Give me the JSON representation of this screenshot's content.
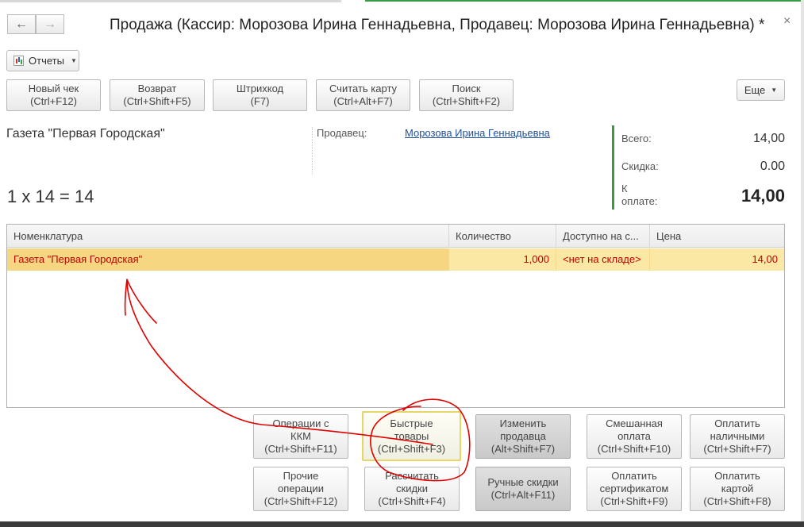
{
  "window": {
    "title": "Продажа (Кассир: Морозова Ирина Геннадьевна, Продавец: Морозова Ирина Геннадьевна) *",
    "close_label": "×"
  },
  "nav": {
    "back": "🡐",
    "forward": "🡒"
  },
  "reports": {
    "label": "Отчеты"
  },
  "toolbar": {
    "new_check": {
      "line1": "Новый чек",
      "line2": "(Ctrl+F12)"
    },
    "return": {
      "line1": "Возврат",
      "line2": "(Ctrl+Shift+F5)"
    },
    "barcode": {
      "line1": "Штрихкод",
      "line2": "(F7)"
    },
    "read_card": {
      "line1": "Считать карту",
      "line2": "(Ctrl+Alt+F7)"
    },
    "search": {
      "line1": "Поиск",
      "line2": "(Ctrl+Shift+F2)"
    },
    "more": "Еще"
  },
  "current": {
    "product_name": "Газета \"Первая Городская\"",
    "calc": "1 x 14 = 14",
    "seller_label": "Продавец:",
    "seller_name": "Морозова Ирина Геннадьевна"
  },
  "totals": {
    "total_label": "Всего:",
    "total_value": "14,00",
    "discount_label": "Скидка:",
    "discount_value": "0.00",
    "pay_label_1": "К",
    "pay_label_2": "оплате:",
    "pay_value": "14,00"
  },
  "table": {
    "columns": [
      "Номенклатура",
      "Количество",
      "Доступно на с...",
      "Цена"
    ],
    "rows": [
      {
        "name": "Газета \"Первая Городская\"",
        "qty": "1,000",
        "available": "<нет на складе>",
        "price": "14,00"
      }
    ]
  },
  "actions": {
    "kkm": {
      "line1": "Операции с",
      "line2": "ККМ",
      "line3": "(Ctrl+Shift+F11)"
    },
    "quick": {
      "line1": "Быстрые",
      "line2": "товары",
      "line3": "(Ctrl+Shift+F3)"
    },
    "change_seller": {
      "line1": "Изменить",
      "line2": "продавца",
      "line3": "(Alt+Shift+F7)"
    },
    "mixed": {
      "line1": "Смешанная",
      "line2": "оплата",
      "line3": "(Ctrl+Shift+F10)"
    },
    "cash": {
      "line1": "Оплатить",
      "line2": "наличными",
      "line3": "(Ctrl+Shift+F7)"
    },
    "other": {
      "line1": "Прочие",
      "line2": "операции",
      "line3": "(Ctrl+Shift+F12)"
    },
    "calc_discounts": {
      "line1": "Рассчитать",
      "line2": "скидки",
      "line3": "(Ctrl+Shift+F4)"
    },
    "manual_discounts": {
      "line1": "Ручные скидки",
      "line2": "(Ctrl+Alt+F11)"
    },
    "certificate": {
      "line1": "Оплатить",
      "line2": "сертификатом",
      "line3": "(Ctrl+Shift+F9)"
    },
    "card": {
      "line1": "Оплатить",
      "line2": "картой",
      "line3": "(Ctrl+Shift+F8)"
    }
  },
  "colors": {
    "accent_green": "#3a9a45",
    "row_highlight": "#fbe8a4",
    "row_text": "#c00000",
    "annotation_red": "#e00000"
  }
}
